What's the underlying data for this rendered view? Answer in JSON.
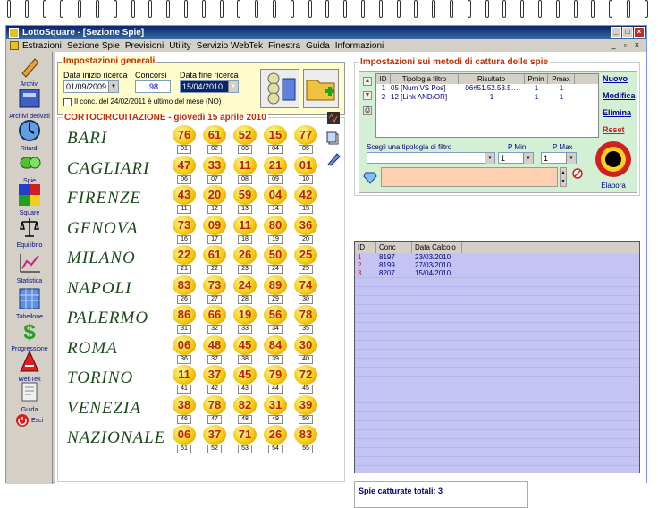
{
  "window": {
    "title": "LottoSquare - [Sezione Spie]"
  },
  "menu": [
    "Estrazioni",
    "Sezione Spie",
    "Previsioni",
    "Utility",
    "Servizio WebTek",
    "Finestra",
    "Guida",
    "Informazioni"
  ],
  "sidebar": [
    {
      "label": "Archivi",
      "icon": "pencil-icon"
    },
    {
      "label": "Archivi derivati",
      "icon": "archive-icon"
    },
    {
      "label": "Ritardi",
      "icon": "clock-icon"
    },
    {
      "label": "Spie",
      "icon": "binoculars-icon"
    },
    {
      "label": "Square",
      "icon": "square-icon"
    },
    {
      "label": "Equilibrio",
      "icon": "scale-icon"
    },
    {
      "label": "Statistica",
      "icon": "stats-icon"
    },
    {
      "label": "Tabellone",
      "icon": "calendar-icon"
    },
    {
      "label": "Progressione",
      "icon": "dollar-icon"
    },
    {
      "label": "WebTek",
      "icon": "webtek-icon"
    },
    {
      "label": "Guida",
      "icon": "book-icon"
    },
    {
      "label": "Esci",
      "icon": "exit-icon"
    }
  ],
  "general": {
    "title": "Impostazioni generali",
    "start_label": "Data inizio ricerca",
    "start_value": "01/09/2009",
    "concorsi_label": "Concorsi",
    "concorsi_value": "98",
    "end_label": "Data fine ricerca",
    "end_value": "15/04/2010",
    "checkbox_label": "Il conc. del 24/02/2011 è ultimo del mese (NO)"
  },
  "cort": {
    "title": "CORTOCIRCUITAZIONE - giovedì 15 aprile 2010",
    "rows": [
      {
        "city": "BARI",
        "balls": [
          "76",
          "61",
          "52",
          "15",
          "77"
        ],
        "nums": [
          "01",
          "02",
          "03",
          "04",
          "05"
        ]
      },
      {
        "city": "CAGLIARI",
        "balls": [
          "47",
          "33",
          "11",
          "21",
          "01"
        ],
        "nums": [
          "06",
          "07",
          "08",
          "09",
          "10"
        ]
      },
      {
        "city": "FIRENZE",
        "balls": [
          "43",
          "20",
          "59",
          "04",
          "42"
        ],
        "nums": [
          "11",
          "12",
          "13",
          "14",
          "15"
        ]
      },
      {
        "city": "GENOVA",
        "balls": [
          "73",
          "09",
          "11",
          "80",
          "36"
        ],
        "nums": [
          "16",
          "17",
          "18",
          "19",
          "20"
        ]
      },
      {
        "city": "MILANO",
        "balls": [
          "22",
          "61",
          "26",
          "50",
          "25"
        ],
        "nums": [
          "21",
          "22",
          "23",
          "24",
          "25"
        ]
      },
      {
        "city": "NAPOLI",
        "balls": [
          "83",
          "73",
          "24",
          "89",
          "74"
        ],
        "nums": [
          "26",
          "27",
          "28",
          "29",
          "30"
        ]
      },
      {
        "city": "PALERMO",
        "balls": [
          "86",
          "66",
          "19",
          "56",
          "78"
        ],
        "nums": [
          "31",
          "32",
          "33",
          "34",
          "35"
        ]
      },
      {
        "city": "ROMA",
        "balls": [
          "06",
          "48",
          "45",
          "84",
          "30"
        ],
        "nums": [
          "36",
          "37",
          "38",
          "39",
          "40"
        ]
      },
      {
        "city": "TORINO",
        "balls": [
          "11",
          "37",
          "45",
          "79",
          "72"
        ],
        "nums": [
          "41",
          "42",
          "43",
          "44",
          "45"
        ]
      },
      {
        "city": "VENEZIA",
        "balls": [
          "38",
          "78",
          "82",
          "31",
          "39"
        ],
        "nums": [
          "46",
          "47",
          "48",
          "49",
          "50"
        ]
      },
      {
        "city": "NAZIONALE",
        "balls": [
          "06",
          "37",
          "71",
          "26",
          "83"
        ],
        "nums": [
          "51",
          "52",
          "53",
          "54",
          "55"
        ]
      }
    ]
  },
  "spie": {
    "title": "Impostazioni sui metodi di cattura delle spie",
    "headers": [
      "ID",
      "Tipologia filtro",
      "Risultato",
      "Pmin",
      "Pmax"
    ],
    "rows": [
      [
        "1",
        "05 [Num VS Pos]",
        "06#51.52.53.5…",
        "1",
        "1"
      ],
      [
        "2",
        "12 [Link AND/OR]",
        "1",
        "1",
        "1"
      ]
    ],
    "links": [
      "Nuovo",
      "Modifica",
      "Elimina",
      "Reset"
    ],
    "filter_label": "Scegli una tipologia di filtro",
    "pmin_label": "P Min",
    "pmax_label": "P Max",
    "pmin_value": "1",
    "pmax_value": "1",
    "elabora": "Elabora"
  },
  "results": {
    "headers": [
      "ID",
      "Conc",
      "Data Calcolo"
    ],
    "rows": [
      [
        "1",
        "8197",
        "23/03/2010"
      ],
      [
        "2",
        "8199",
        "27/03/2010"
      ],
      [
        "3",
        "8207",
        "15/04/2010"
      ]
    ]
  },
  "status": "Spie catturate totali: 3"
}
